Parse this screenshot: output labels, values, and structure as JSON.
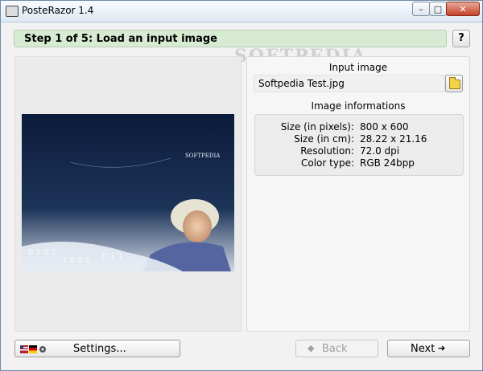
{
  "window": {
    "title": "PosteRazor 1.4",
    "buttons": {
      "minimize": "–",
      "maximize": "□",
      "close": "✕"
    }
  },
  "watermark": "SOFTPEDIA",
  "step": {
    "label": "Step 1 of 5: Load an input image",
    "help_label": "?"
  },
  "input": {
    "heading": "Input image",
    "filename": "Softpedia Test.jpg",
    "open_icon": "folder-icon"
  },
  "info": {
    "heading": "Image informations",
    "rows": [
      {
        "key": "Size (in pixels):",
        "value": "800 x 600"
      },
      {
        "key": "Size (in cm):",
        "value": "28.22 x 21.16"
      },
      {
        "key": "Resolution:",
        "value": "72.0 dpi"
      },
      {
        "key": "Color type:",
        "value": "RGB 24bpp"
      }
    ]
  },
  "preview": {
    "logo_text": "SOFTPEDIA",
    "background": "#0f2140"
  },
  "footer": {
    "settings_label": "Settings...",
    "back_label": "Back",
    "next_label": "Next"
  }
}
